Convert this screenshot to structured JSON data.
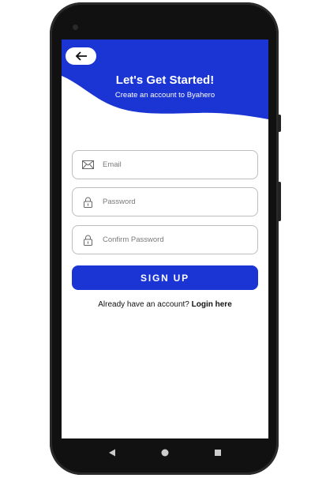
{
  "header": {
    "title": "Let's Get Started!",
    "subtitle": "Create an account to Byahero",
    "back_icon": "arrow-left-icon",
    "color": "#1a35d4"
  },
  "form": {
    "email": {
      "placeholder": "Email",
      "value": "",
      "icon": "envelope-icon"
    },
    "password": {
      "placeholder": "Password",
      "value": "",
      "icon": "lock-icon"
    },
    "confirm_password": {
      "placeholder": "Confirm Password",
      "value": "",
      "icon": "lock-icon"
    },
    "signup_label": "SIGN UP"
  },
  "footer": {
    "prompt": "Already have an account?",
    "link": "Login here"
  },
  "navbar": {
    "back": "triangle-back-icon",
    "home": "circle-home-icon",
    "recents": "square-recents-icon"
  }
}
